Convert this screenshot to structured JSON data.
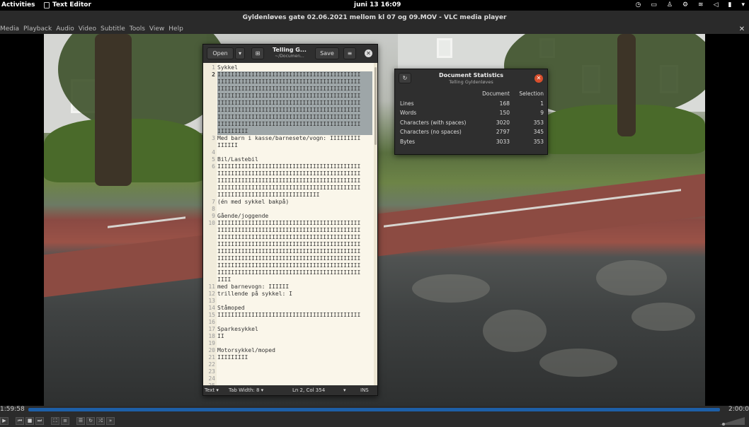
{
  "topbar": {
    "activities": "Activities",
    "app_name": "Text Editor",
    "clock": "juni 13  16:09"
  },
  "vlc": {
    "window_title": "Gyldenløves gate 02.06.2021 mellom kl 07 og 09.MOV - VLC media player",
    "menu": [
      "Media",
      "Playback",
      "Audio",
      "Video",
      "Subtitle",
      "Tools",
      "View",
      "Help"
    ],
    "time_elapsed": "1:59:58",
    "time_total": "2:00:0",
    "progress": 0.999
  },
  "gedit": {
    "open_label": "Open",
    "title": "Telling G...",
    "subtitle": "~/Documen...",
    "save_label": "Save",
    "lines": [
      {
        "n": "1",
        "t": "Sykkel"
      },
      {
        "n": "2",
        "t": "IIIIIIIIIIIIIIIIIIIIIIIIIIIIIIIIIIIIIIIIII",
        "sel": true
      },
      {
        "n": "",
        "t": "IIIIIIIIIIIIIIIIIIIIIIIIIIIIIIIIIIIIIIIIII",
        "sel": true
      },
      {
        "n": "",
        "t": "IIIIIIIIIIIIIIIIIIIIIIIIIIIIIIIIIIIIIIIIII",
        "sel": true
      },
      {
        "n": "",
        "t": "IIIIIIIIIIIIIIIIIIIIIIIIIIIIIIIIIIIIIIIIII",
        "sel": true
      },
      {
        "n": "",
        "t": "IIIIIIIIIIIIIIIIIIIIIIIIIIIIIIIIIIIIIIIIII",
        "sel": true
      },
      {
        "n": "",
        "t": "IIIIIIIIIIIIIIIIIIIIIIIIIIIIIIIIIIIIIIIIII",
        "sel": true
      },
      {
        "n": "",
        "t": "IIIIIIIIIIIIIIIIIIIIIIIIIIIIIIIIIIIIIIIIII",
        "sel": true
      },
      {
        "n": "",
        "t": "IIIIIIIIIIIIIIIIIIIIIIIIIIIIIIIIIIIIIIIIII",
        "sel": true
      },
      {
        "n": "",
        "t": "IIIIIIIII",
        "sel": true
      },
      {
        "n": "3",
        "t": "Med barn i kasse/barnesete/vogn: IIIIIIIII"
      },
      {
        "n": "",
        "t": "IIIIII"
      },
      {
        "n": "4",
        "t": ""
      },
      {
        "n": "5",
        "t": "Bil/Lastebil"
      },
      {
        "n": "6",
        "t": "IIIIIIIIIIIIIIIIIIIIIIIIIIIIIIIIIIIIIIIIII"
      },
      {
        "n": "",
        "t": "IIIIIIIIIIIIIIIIIIIIIIIIIIIIIIIIIIIIIIIIII"
      },
      {
        "n": "",
        "t": "IIIIIIIIIIIIIIIIIIIIIIIIIIIIIIIIIIIIIIIIII"
      },
      {
        "n": "",
        "t": "IIIIIIIIIIIIIIIIIIIIIIIIIIIIIIIIIIIIIIIIII"
      },
      {
        "n": "",
        "t": "IIIIIIIIIIIIIIIIIIIIIIIIIIIIII"
      },
      {
        "n": "7",
        "t": "(én med sykkel bakpå)"
      },
      {
        "n": "8",
        "t": ""
      },
      {
        "n": "9",
        "t": "Gående/joggende"
      },
      {
        "n": "10",
        "t": "IIIIIIIIIIIIIIIIIIIIIIIIIIIIIIIIIIIIIIIIII"
      },
      {
        "n": "",
        "t": "IIIIIIIIIIIIIIIIIIIIIIIIIIIIIIIIIIIIIIIIII"
      },
      {
        "n": "",
        "t": "IIIIIIIIIIIIIIIIIIIIIIIIIIIIIIIIIIIIIIIIII"
      },
      {
        "n": "",
        "t": "IIIIIIIIIIIIIIIIIIIIIIIIIIIIIIIIIIIIIIIIII"
      },
      {
        "n": "",
        "t": "IIIIIIIIIIIIIIIIIIIIIIIIIIIIIIIIIIIIIIIIII"
      },
      {
        "n": "",
        "t": "IIIIIIIIIIIIIIIIIIIIIIIIIIIIIIIIIIIIIIIIII"
      },
      {
        "n": "",
        "t": "IIIIIIIIIIIIIIIIIIIIIIIIIIIIIIIIIIIIIIIIII"
      },
      {
        "n": "",
        "t": "IIIIIIIIIIIIIIIIIIIIIIIIIIIIIIIIIIIIIIIIII"
      },
      {
        "n": "",
        "t": "IIII"
      },
      {
        "n": "11",
        "t": "med barnevogn: IIIIII"
      },
      {
        "n": "12",
        "t": "trillende på sykkel: I"
      },
      {
        "n": "13",
        "t": ""
      },
      {
        "n": "14",
        "t": "Ståmoped"
      },
      {
        "n": "15",
        "t": "IIIIIIIIIIIIIIIIIIIIIIIIIIIIIIIIIIIIIIIIII"
      },
      {
        "n": "16",
        "t": ""
      },
      {
        "n": "17",
        "t": "Sparkesykkel"
      },
      {
        "n": "18",
        "t": "II"
      },
      {
        "n": "19",
        "t": ""
      },
      {
        "n": "20",
        "t": "Motorsykkel/moped"
      },
      {
        "n": "21",
        "t": "IIIIIIIII"
      },
      {
        "n": "22",
        "t": ""
      },
      {
        "n": "23",
        "t": ""
      },
      {
        "n": "24",
        "t": ""
      },
      {
        "n": "25",
        "t": ""
      }
    ],
    "current_line": "2",
    "status_language": "Text ▾",
    "status_tabwidth": "Tab Width: 8 ▾",
    "status_position": "Ln 2, Col 354",
    "status_mode": "INS"
  },
  "stats": {
    "title": "Document Statistics",
    "subtitle": "Telling Gyldenløves",
    "col_document": "Document",
    "col_selection": "Selection",
    "rows": [
      {
        "label": "Lines",
        "document": "168",
        "selection": "1"
      },
      {
        "label": "Words",
        "document": "150",
        "selection": "9"
      },
      {
        "label": "Characters (with spaces)",
        "document": "3020",
        "selection": "353"
      },
      {
        "label": "Characters (no spaces)",
        "document": "2797",
        "selection": "345"
      },
      {
        "label": "Bytes",
        "document": "3033",
        "selection": "353"
      }
    ]
  },
  "colors": {
    "seekbar": "#1d5fa8",
    "close_red": "#d94f2d",
    "editor_bg": "#faf6ea",
    "selection": "#9ea6a8"
  }
}
